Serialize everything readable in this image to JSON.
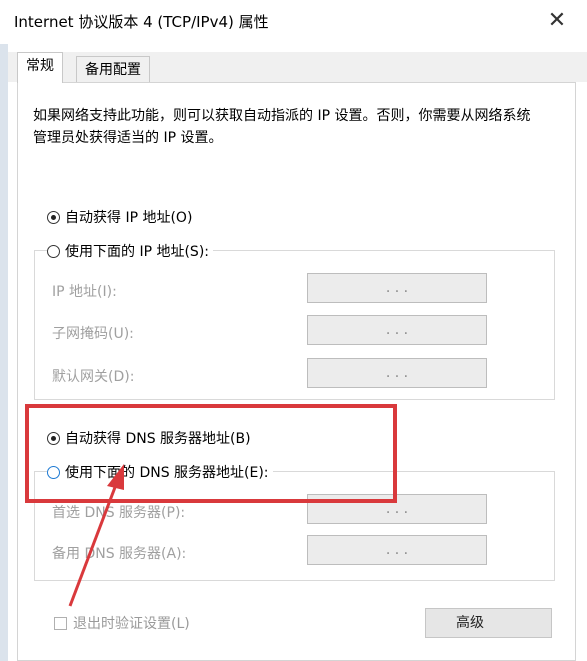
{
  "window": {
    "title": "Internet 协议版本 4 (TCP/IPv4) 属性",
    "close_glyph": "✕"
  },
  "tabs": [
    {
      "label": "常规"
    },
    {
      "label": "备用配置"
    }
  ],
  "description": "如果网络支持此功能，则可以获取自动指派的 IP 设置。否则，你需要从网络系统管理员处获得适当的 IP 设置。",
  "ip": {
    "auto_label": "自动获得 IP 地址(O)",
    "auto_selected": true,
    "manual_label": "使用下面的 IP 地址(S):",
    "manual_selected": false,
    "fields": [
      {
        "label": "IP 地址(I):",
        "value": ". . ."
      },
      {
        "label": "子网掩码(U):",
        "value": ". . ."
      },
      {
        "label": "默认网关(D):",
        "value": ". . ."
      }
    ]
  },
  "dns": {
    "auto_label": "自动获得 DNS 服务器地址(B)",
    "auto_selected": true,
    "manual_label": "使用下面的 DNS 服务器地址(E):",
    "manual_selected": false,
    "fields": [
      {
        "label": "首选 DNS 服务器(P):",
        "value": ". . ."
      },
      {
        "label": "备用 DNS 服务器(A):",
        "value": ". . ."
      }
    ]
  },
  "validate_label": "退出时验证设置(L)",
  "advanced_label": "高级",
  "annotation_color": "#d9393c"
}
